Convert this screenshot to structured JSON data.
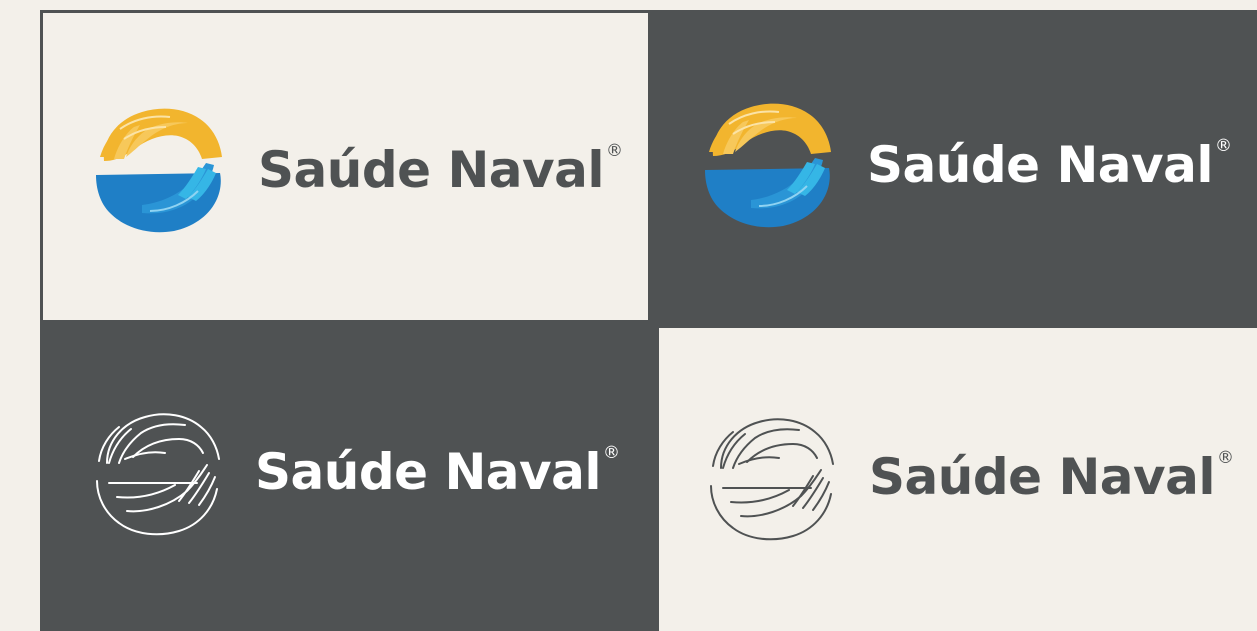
{
  "brand": {
    "name": "Saúde Naval",
    "registered_mark": "®"
  },
  "colors": {
    "light_background": "#f3f0ea",
    "dark_background": "#4f5253",
    "wordmark_dark": "#4f5253",
    "wordmark_light": "#ffffff",
    "hand_top": "#f2b52e",
    "hand_bottom": "#1f7fc6",
    "hand_bottom_accent": "#35b6e6"
  },
  "variants": [
    {
      "style": "full-color",
      "background": "light"
    },
    {
      "style": "full-color",
      "background": "dark"
    },
    {
      "style": "outline",
      "background": "dark"
    },
    {
      "style": "outline",
      "background": "light"
    }
  ],
  "icons": [
    "hands-circle-icon"
  ]
}
